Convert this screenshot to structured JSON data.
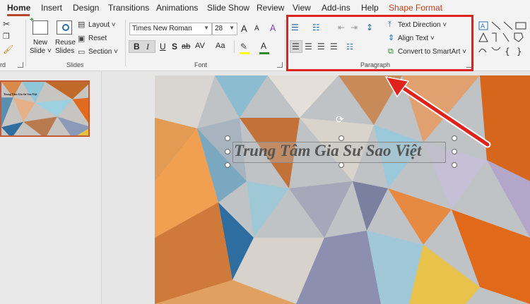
{
  "tabs": [
    {
      "label": "Home"
    },
    {
      "label": "Insert"
    },
    {
      "label": "Design"
    },
    {
      "label": "Transitions"
    },
    {
      "label": "Animations"
    },
    {
      "label": "Slide Show"
    },
    {
      "label": "Review"
    },
    {
      "label": "View"
    },
    {
      "label": "Add-ins"
    },
    {
      "label": "Help"
    },
    {
      "label": "Shape Format"
    }
  ],
  "slides_group": {
    "new_slide": [
      "New",
      "Slide ˅"
    ],
    "reuse_slides": [
      "Reuse",
      "Slides"
    ],
    "layout": "Layout ˅",
    "reset": "Reset",
    "section": "Section ˅",
    "label": "Slides"
  },
  "clipboard_group": {
    "label_fragment": "rd"
  },
  "font_group": {
    "font_name": "Times New Roman",
    "font_size": "28",
    "bold": "B",
    "italic": "I",
    "underline": "U",
    "strike": "S",
    "shadow": "ab",
    "spacing": "AV",
    "case": "Aa",
    "grow": "A",
    "shrink": "A",
    "font_color": "A",
    "label": "Font"
  },
  "paragraph_group": {
    "text_direction": "Text Direction ˅",
    "align_text": "Align Text ˅",
    "convert_smartart": "Convert to SmartArt ˅",
    "label": "Paragraph"
  },
  "slide_title": "Trung Tâm Gia Sư Sao Việt",
  "thumbnail_text": "Trung Tâm Gia Sư Sao Việt",
  "colors": {
    "accent": "#b7472a",
    "highlight": "#e0221c",
    "shape_format": "#c43e1c"
  }
}
